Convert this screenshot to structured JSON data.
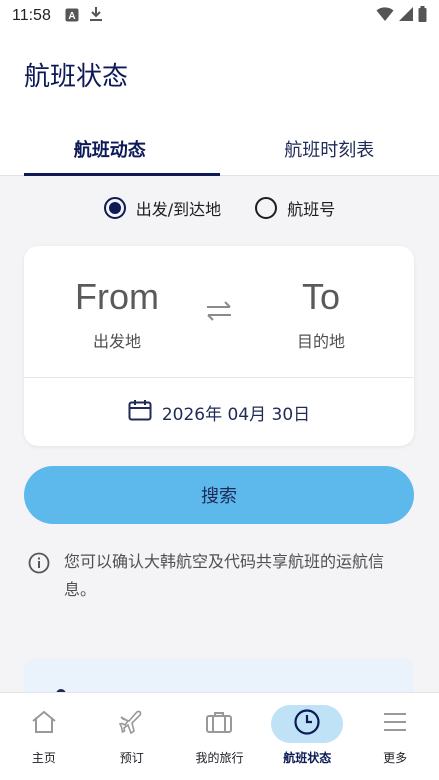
{
  "status_bar": {
    "time": "11:58"
  },
  "header": {
    "title": "航班状态"
  },
  "tabs": [
    {
      "label": "航班动态",
      "active": true
    },
    {
      "label": "航班时刻表",
      "active": false
    }
  ],
  "search_type": {
    "options": [
      {
        "label": "出发/到达地",
        "selected": true
      },
      {
        "label": "航班号",
        "selected": false
      }
    ]
  },
  "route": {
    "from": {
      "code": "From",
      "label": "出发地"
    },
    "to": {
      "code": "To",
      "label": "目的地"
    }
  },
  "date": {
    "value": "2026年 04月 30日"
  },
  "search_button": {
    "label": "搜索"
  },
  "info": {
    "text": "您可以确认大韩航空及代码共享航班的运航信息。"
  },
  "bottom_nav": [
    {
      "label": "主页",
      "icon": "home-icon",
      "active": false
    },
    {
      "label": "预订",
      "icon": "plane-icon",
      "active": false
    },
    {
      "label": "我的旅行",
      "icon": "luggage-icon",
      "active": false
    },
    {
      "label": "航班状态",
      "icon": "clock-icon",
      "active": true
    },
    {
      "label": "更多",
      "icon": "menu-icon",
      "active": false
    }
  ],
  "colors": {
    "navy": "#0d1a57",
    "search_button": "#5db9ec",
    "nav_active_bg": "#bfe2f7"
  }
}
